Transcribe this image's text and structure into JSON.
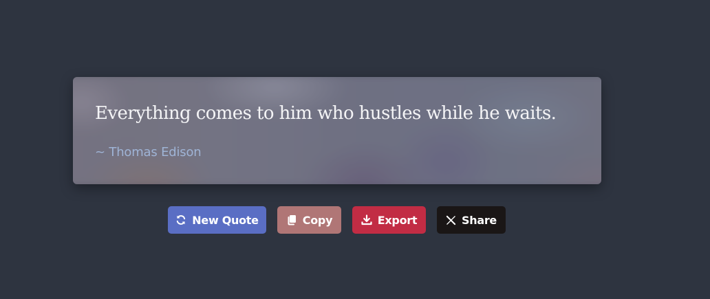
{
  "quote": {
    "text": "Everything comes to him who hustles while he waits.",
    "author": "~ Thomas Edison"
  },
  "actions": {
    "new_quote": {
      "label": "New Quote",
      "icon": "refresh-icon",
      "color": "#5a6ec4"
    },
    "copy": {
      "label": "Copy",
      "icon": "copy-icon",
      "color": "#b07676"
    },
    "export": {
      "label": "Export",
      "icon": "download-icon",
      "color": "#c22c44"
    },
    "share": {
      "label": "Share",
      "icon": "x-logo-icon",
      "color": "#1a1616"
    }
  },
  "theme": {
    "background": "#2e3440",
    "author_color": "#9fb4d6"
  }
}
